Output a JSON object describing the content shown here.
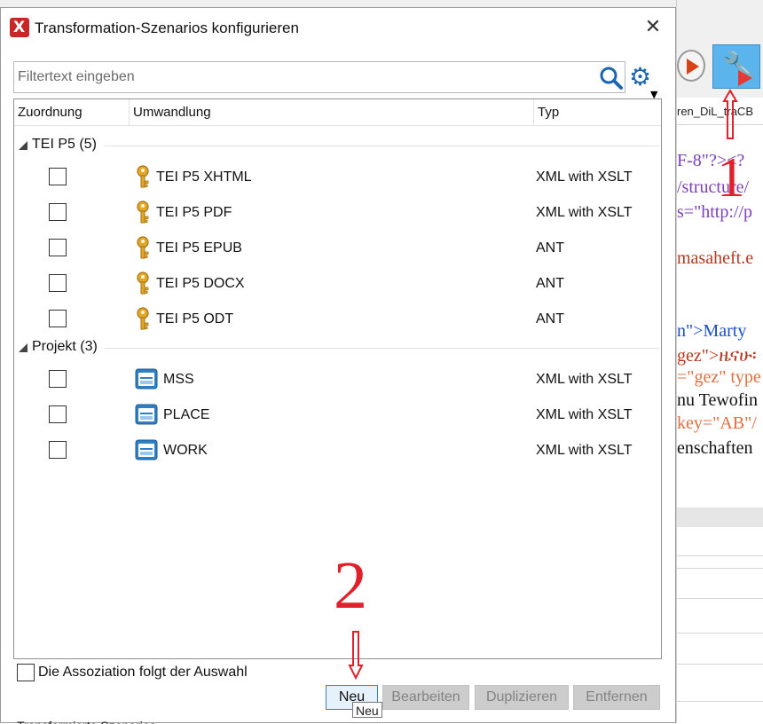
{
  "dialog": {
    "title": "Transformation-Szenarios konfigurieren",
    "close_label": "✕",
    "filter_placeholder": "Filtertext eingeben",
    "columns": {
      "zuordnung": "Zuordnung",
      "umwandlung": "Umwandlung",
      "typ": "Typ"
    },
    "groups": [
      {
        "label": "TEI P5 (5)",
        "rows": [
          {
            "name": "TEI P5 XHTML",
            "type": "XML with XSLT",
            "icon": "key-icon"
          },
          {
            "name": "TEI P5 PDF",
            "type": "XML with XSLT",
            "icon": "key-icon"
          },
          {
            "name": "TEI P5 EPUB",
            "type": "ANT",
            "icon": "key-icon"
          },
          {
            "name": "TEI P5 DOCX",
            "type": "ANT",
            "icon": "key-icon"
          },
          {
            "name": "TEI P5 ODT",
            "type": "ANT",
            "icon": "key-icon"
          }
        ]
      },
      {
        "label": "Projekt (3)",
        "rows": [
          {
            "name": "MSS",
            "type": "XML with XSLT",
            "icon": "project-icon"
          },
          {
            "name": "PLACE",
            "type": "XML with XSLT",
            "icon": "project-icon"
          },
          {
            "name": "WORK",
            "type": "XML with XSLT",
            "icon": "project-icon"
          }
        ]
      }
    ],
    "association_label": "Die Assoziation folgt der Auswahl",
    "buttons": {
      "new": "Neu",
      "edit": "Bearbeiten",
      "duplicate": "Duplizieren",
      "remove": "Entfernen"
    },
    "tooltip": "Neu",
    "bottom_partial": "Transformierte Szenarios"
  },
  "editor": {
    "tab": "ren_DiL_traCB",
    "lines": [
      {
        "text": "F-8\"?><?",
        "color": "#7b3fb8"
      },
      {
        "text": "/structure/",
        "color": "#7b3fb8"
      },
      {
        "text": "s=\"http://p",
        "color": "#7b3fb8"
      },
      {
        "text": "masaheft.e",
        "color": "#b5391f"
      },
      {
        "text": "n\">Marty",
        "color": "#1a4fcc"
      },
      {
        "text": "gez\">ዜናሁ፡",
        "color": "#b5391f"
      },
      {
        "text": "=\"gez\" type",
        "color": "#e07040"
      },
      {
        "text": "nu Tewofin",
        "color": "#111111"
      },
      {
        "text": "key=\"AB\"/",
        "color": "#e07040"
      },
      {
        "text": "enschaften",
        "color": "#111111"
      }
    ]
  },
  "annotations": {
    "one": "1",
    "two": "2"
  }
}
